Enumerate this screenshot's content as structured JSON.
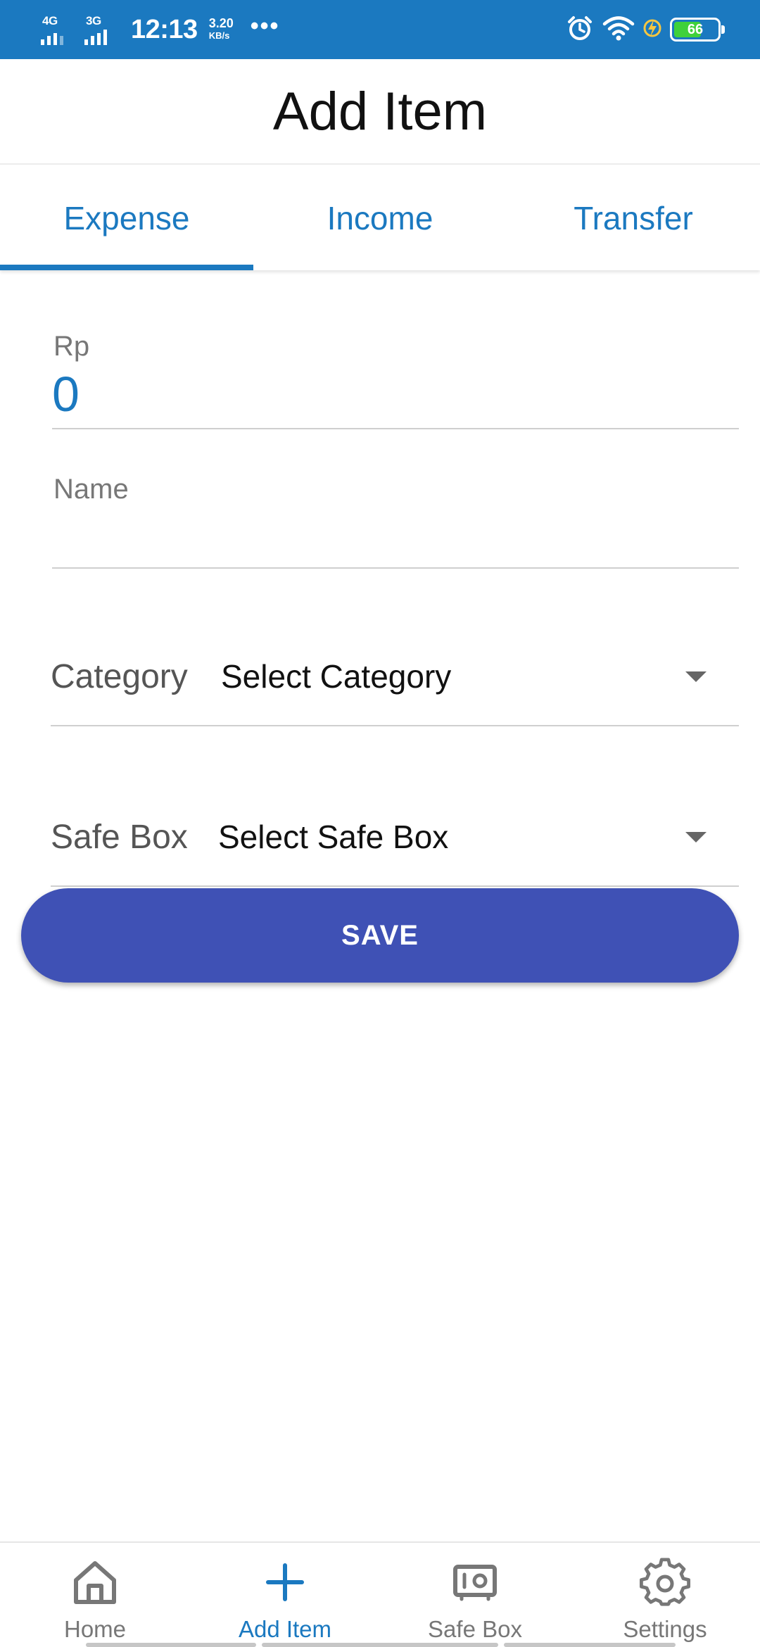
{
  "status_bar": {
    "network1": "4G",
    "network2": "3G",
    "time": "12:13",
    "speed_value": "3.20",
    "speed_unit": "KB/s",
    "more": "•••",
    "battery_level": "66",
    "battery_fraction": 0.66,
    "icons": [
      "signal-icon",
      "alarm-icon",
      "wifi-icon",
      "charging-icon",
      "battery-icon"
    ]
  },
  "header": {
    "title": "Add Item"
  },
  "tabs": [
    {
      "label": "Expense",
      "active": true
    },
    {
      "label": "Income",
      "active": false
    },
    {
      "label": "Transfer",
      "active": false
    }
  ],
  "form": {
    "currency": "Rp",
    "amount": "0",
    "name_placeholder": "Name",
    "name_value": "",
    "category_label": "Category",
    "category_value": "Select Category",
    "safebox_label": "Safe Box",
    "safebox_value": "Select Safe Box",
    "save_label": "SAVE"
  },
  "bottom_nav": [
    {
      "label": "Home",
      "icon": "home-icon",
      "active": false
    },
    {
      "label": "Add Item",
      "icon": "plus-icon",
      "active": true
    },
    {
      "label": "Safe Box",
      "icon": "safe-icon",
      "active": false
    },
    {
      "label": "Settings",
      "icon": "gear-icon",
      "active": false
    }
  ],
  "colors": {
    "primary": "#1b79c0",
    "button": "#3f51b5",
    "battery_fill": "#3fd13b",
    "inactive": "#777777"
  }
}
